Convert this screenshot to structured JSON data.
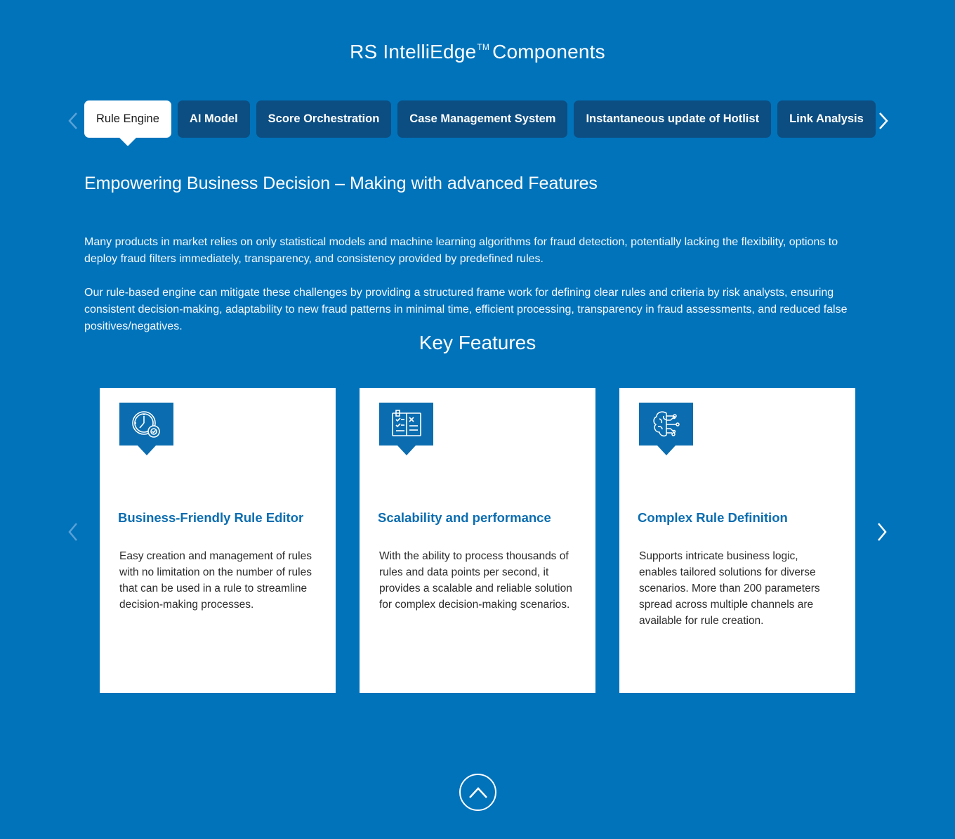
{
  "page": {
    "title_main": "RS IntelliEdge",
    "title_tm": "TM",
    "title_suffix": "Components"
  },
  "tabs": {
    "prev_icon": "chevron-left-icon",
    "next_icon": "chevron-right-icon",
    "items": [
      {
        "label": "Rule Engine",
        "active": true
      },
      {
        "label": "AI Model",
        "active": false
      },
      {
        "label": "Score Orchestration",
        "active": false
      },
      {
        "label": "Case Management System",
        "active": false
      },
      {
        "label": "Instantaneous update of Hotlist",
        "active": false
      },
      {
        "label": "Link Analysis",
        "active": false
      }
    ]
  },
  "content": {
    "heading": "Empowering Business Decision – Making with advanced Features",
    "paragraph1": "Many products in market relies on only statistical models and machine learning algorithms for fraud detection, potentially lacking the flexibility, options to deploy fraud filters immediately, transparency, and consistency provided by predefined rules.",
    "paragraph2": "Our rule-based engine can mitigate these challenges by providing a structured frame work for defining clear rules and criteria by risk analysts, ensuring consistent decision-making, adaptability to new fraud patterns in minimal time, efficient processing, transparency in fraud assessments, and reduced false positives/negatives."
  },
  "key_features": {
    "title": "Key Features",
    "cards": [
      {
        "icon": "clock-gear-icon",
        "title": "Business-Friendly Rule Editor",
        "text": "Easy creation and management of rules with no limitation on the number of rules that can be used in a rule to streamline decision-making processes."
      },
      {
        "icon": "rulebook-icon",
        "title": "Scalability and performance",
        "text": "With the ability to process thousands of rules and data points per second, it provides a scalable and reliable solution for complex decision-making scenarios."
      },
      {
        "icon": "brain-circuit-icon",
        "title": "Complex Rule Definition",
        "text": "Supports intricate business logic, enables tailored solutions for diverse scenarios. More than 200 parameters spread across multiple channels are available for rule creation."
      }
    ]
  },
  "colors": {
    "background": "#0073bb",
    "tab_inactive": "#0c4e82",
    "tab_active": "#ffffff",
    "accent": "#0b6db0"
  }
}
